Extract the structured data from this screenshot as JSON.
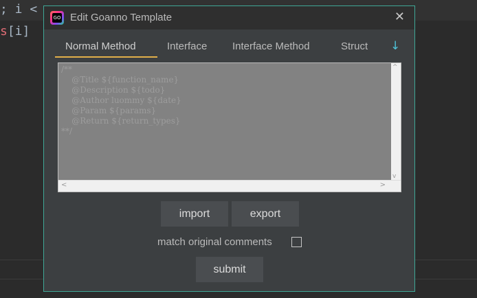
{
  "background": {
    "line1": "; i < ",
    "line2_var": "s",
    "line2_rest": "[i]"
  },
  "dialog": {
    "title": "Edit Goanno Template",
    "app_icon_text": "GO",
    "close_symbol": "✕",
    "tabs": [
      {
        "label": "Normal Method",
        "active": true
      },
      {
        "label": "Interface",
        "active": false
      },
      {
        "label": "Interface Method",
        "active": false
      },
      {
        "label": "Struct",
        "active": false
      }
    ],
    "more_tabs_symbol": "↓",
    "template_text": "/**\n    @Title ${function_name}\n    @Description ${todo}\n    @Author luommy ${date}\n    @Param ${params}\n    @Return ${return_types}\n**/",
    "import_label": "import",
    "export_label": "export",
    "match_label": "match original comments",
    "match_checked": false,
    "submit_label": "submit"
  },
  "colors": {
    "accent_border": "#3fa897",
    "tab_underline": "#e2b04a"
  }
}
